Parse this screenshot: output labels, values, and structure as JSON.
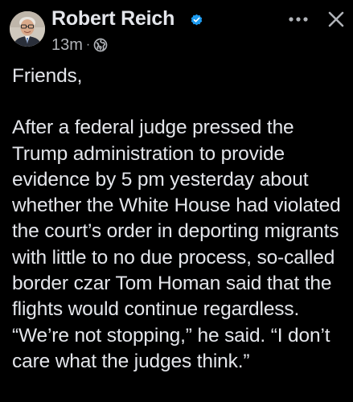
{
  "author": {
    "name": "Robert Reich",
    "verified": true
  },
  "meta": {
    "timestamp": "13m",
    "separator": "·",
    "audience_icon": "globe-icon"
  },
  "actions": {
    "more_icon": "more-horizontal-icon",
    "close_icon": "close-icon"
  },
  "post": {
    "greeting": "Friends,",
    "paragraph": "After a federal judge pressed the Trump administration to provide evidence by 5 pm yesterday about whether the White House had violated the court’s order in deporting migrants with little to no due process, so-called border czar Tom Homan said that the flights would continue regardless. “We’re not stopping,” he said. “I don’t care what the judges think.”"
  },
  "colors": {
    "background": "#000000",
    "text_primary": "#e4e6eb",
    "text_secondary": "#b0b3b8",
    "verified_blue": "#1d9bf0"
  }
}
